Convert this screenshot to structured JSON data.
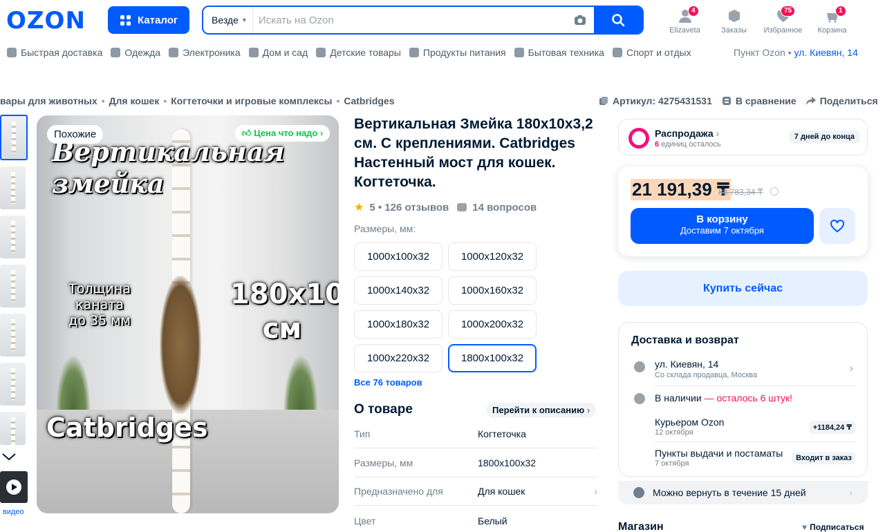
{
  "header": {
    "logo": "OZON",
    "catalog_label": "Каталог",
    "search_scope": "Везде",
    "search_placeholder": "Искать на Ozon",
    "icons": [
      {
        "label": "Elizaveta",
        "badge": "4",
        "icon": "user-icon"
      },
      {
        "label": "Заказы",
        "badge": "",
        "icon": "box-icon"
      },
      {
        "label": "Избранное",
        "badge": "75",
        "icon": "heart-icon"
      },
      {
        "label": "Корзина",
        "badge": "1",
        "icon": "cart-icon"
      }
    ]
  },
  "catnav": {
    "items": [
      "Быстрая доставка",
      "Одежда",
      "Электроника",
      "Дом и сад",
      "Детские товары",
      "Продукты питания",
      "Бытовая техника",
      "Спорт и отдых"
    ],
    "pickup_label": "Пункт Ozon •",
    "pickup_address": "ул. Киевян, 14"
  },
  "breadcrumb": [
    "вары для животных",
    "Для кошек",
    "Когтеточки и игровые комплексы",
    "Catbridges"
  ],
  "actions": {
    "article": "Артикул: 4275431531",
    "compare": "В сравнение",
    "share": "Поделиться"
  },
  "gallery": {
    "similar": "Похожие",
    "price_tag": "Цена что надо",
    "overlay_title_1": "Вертикальная",
    "overlay_title_2": "змейка",
    "overlay_thick_1": "Толщина",
    "overlay_thick_2": "каната",
    "overlay_thick_3": "до 35 мм",
    "overlay_size_1": "180x10",
    "overlay_size_2": "см",
    "overlay_brand": "Catbridges",
    "video_label": "видео"
  },
  "product": {
    "title": "Вертикальная Змейка 180х10х3,2 см. С креплениями. Catbridges Настенный мост для кошек. Когтеточка.",
    "rating": "5 • 126 отзывов",
    "questions": "14 вопросов",
    "sizes_label": "Размеры, мм:",
    "sizes": [
      "1000x100x32",
      "1000x120x32",
      "1000x140x32",
      "1000x160x32",
      "1000x180x32",
      "1000x200x32",
      "1000x220x32",
      "1800x100x32"
    ],
    "selected_size": "1800x100x32",
    "all_link": "Все 76 товаров",
    "about_title": "О товаре",
    "goto_desc": "Перейти к описанию",
    "specs": [
      {
        "k": "Тип",
        "v": "Когтеточка"
      },
      {
        "k": "Размеры, мм",
        "v": "1800x100x32"
      },
      {
        "k": "Предназначено для",
        "v": "Для кошек"
      },
      {
        "k": "Цвет",
        "v": "Белый"
      }
    ]
  },
  "buy": {
    "sale_title": "Распродажа",
    "sale_count": "6",
    "sale_rest": "единиц осталось",
    "sale_days": "7 дней до конца",
    "price": "21 191,39 ₸",
    "old_price": "88 783,34 ₸",
    "cart_label": "В корзину",
    "cart_sub": "Доставим 7 октября",
    "buy_now": "Купить сейчас"
  },
  "delivery": {
    "title": "Доставка и возврат",
    "address": "ул. Киевян, 14",
    "address_sub": "Со склада продавца, Москва",
    "stock": "В наличии",
    "stock_left": " — осталось 6 штук!",
    "courier": "Курьером Ozon",
    "courier_date": "12 октября",
    "courier_price": "+1184,24 ₸",
    "points": "Пункты выдачи и постаматы",
    "points_date": "7 октября",
    "points_badge": "Входит в заказ",
    "return_text": "Можно вернуть в течение 15 дней"
  },
  "store": {
    "title": "Магазин",
    "subscribe": "Подписаться"
  },
  "colors": {
    "brand": "#005bff",
    "sale": "#f91155",
    "good_price": "#10c44c"
  }
}
